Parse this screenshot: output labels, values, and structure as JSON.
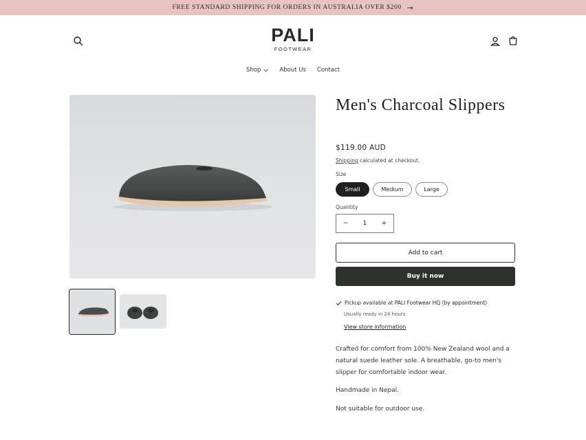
{
  "announcement": {
    "text": "FREE STANDARD SHIPPING FOR ORDERS IN AUSTRALIA OVER $200",
    "arrow": "→"
  },
  "header": {
    "logo_main": "PALI",
    "logo_sub": "FOOTWEAR",
    "icons": [
      "search-icon",
      "account-icon",
      "cart-icon"
    ]
  },
  "nav": {
    "shop": "Shop",
    "about": "About Us",
    "contact": "Contact"
  },
  "product": {
    "title": "Men's Charcoal Slippers",
    "price": "$119.00 AUD",
    "shipping_link": "Shipping",
    "shipping_text": " calculated at checkout.",
    "size_label": "Size",
    "sizes": [
      "Small",
      "Medium",
      "Large"
    ],
    "selected_size": "Small",
    "quantity_label": "Quantity",
    "quantity": "1",
    "minus": "−",
    "plus": "+",
    "add_to_cart": "Add to cart",
    "buy_now": "Buy it now"
  },
  "pickup": {
    "prefix": "Pickup available at ",
    "location": "PALI Footwear HQ (by appointment)",
    "ready": "Usually ready in 24 hours",
    "store_link": "View store information"
  },
  "description": {
    "p1": "Crafted for comfort from 100% New Zealand wool and a natural suede leather sole. A breathable, go-to men's slipper for comfortable indoor wear.",
    "p2": "Handmade in Nepal.",
    "p3": "Not suitable for outdoor use."
  },
  "colors": {
    "announcement_bg": "#e7c3c1",
    "buy_button": "#2e312e",
    "check": "#2a7a3a"
  }
}
